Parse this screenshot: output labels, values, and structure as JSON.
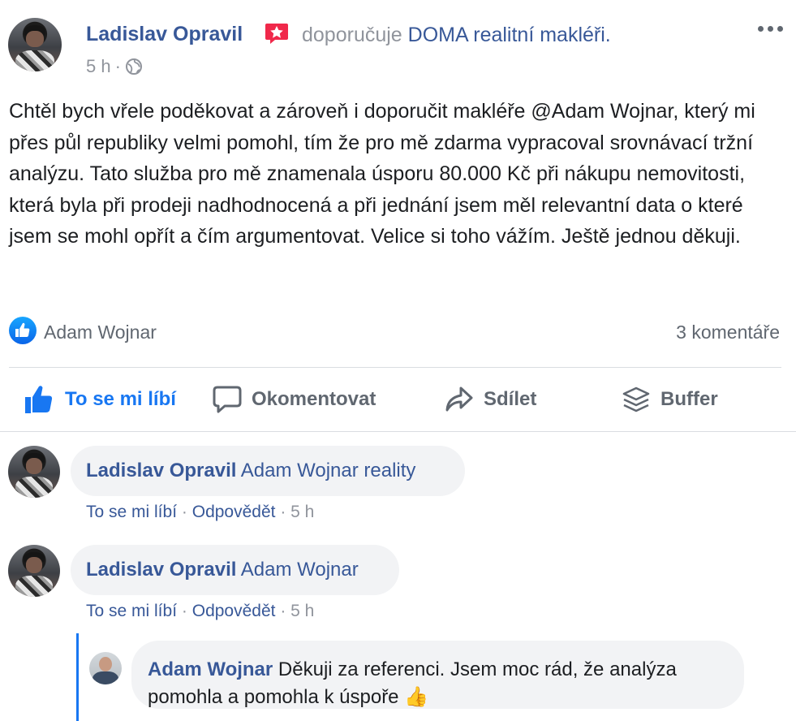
{
  "post": {
    "author": "Ladislav Opravil",
    "recommends_text": "doporučuje",
    "page_name": "DOMA realitní makléři.",
    "time": "5 h",
    "dot": "·",
    "body": "Chtěl bych vřele poděkovat a zároveň i doporučit makléře @Adam Wojnar, který mi přes půl republiky velmi pomohl, tím že pro mě zdarma vypracoval srovnávací tržní analýzu. Tato služba pro mě znamenala úsporu 80.000 Kč při nákupu nemovitosti, která byla při prodeji nadhodnocená a při jednání jsem měl relevantní data o které jsem se mohl opřít a čím argumentovat. Velice si toho vážím. Ještě jednou děkuji.",
    "likers": "Adam Wojnar",
    "comment_count": "3 komentáře"
  },
  "actions": {
    "like": "To se mi líbí",
    "comment": "Okomentovat",
    "share": "Sdílet",
    "buffer": "Buffer"
  },
  "comments": [
    {
      "author": "Ladislav Opravil",
      "text": "Adam Wojnar reality",
      "like": "To se mi líbí",
      "reply": "Odpovědět",
      "time": "5 h"
    },
    {
      "author": "Ladislav Opravil",
      "text": "Adam Wojnar",
      "like": "To se mi líbí",
      "reply": "Odpovědět",
      "time": "5 h"
    }
  ],
  "reply": {
    "author": "Adam Wojnar",
    "text": "Děkuji za referenci. Jsem moc rád, že analýza pomohla a pomohla k úspoře 👍"
  },
  "colors": {
    "link": "#385898",
    "like_blue": "#1877f2",
    "muted": "#90949c",
    "bubble": "#f2f3f5"
  }
}
